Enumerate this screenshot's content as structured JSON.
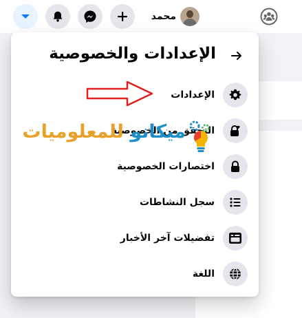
{
  "topbar": {
    "profile_name": "محمد",
    "buttons": [
      {
        "name": "account-menu-button",
        "icon": "chevron-down-icon",
        "active": true
      },
      {
        "name": "notifications-button",
        "icon": "bell-icon"
      },
      {
        "name": "messenger-button",
        "icon": "messenger-icon"
      },
      {
        "name": "create-button",
        "icon": "plus-icon"
      }
    ],
    "groups_icon": "groups-icon"
  },
  "menu": {
    "title": "الإعدادات والخصوصية",
    "back_icon": "arrow-icon",
    "items": [
      {
        "label": "الإعدادات",
        "icon": "gear-icon"
      },
      {
        "label": "التحقق من الخصوصية",
        "icon": "lock-heart-icon"
      },
      {
        "label": "اختصارات الخصوصية",
        "icon": "lock-icon"
      },
      {
        "label": "سجل النشاطات",
        "icon": "list-icon"
      },
      {
        "label": "تفضيلات آخر الأخبار",
        "icon": "feed-icon"
      },
      {
        "label": "اللغة",
        "icon": "globe-icon"
      }
    ]
  },
  "watermark": {
    "part1": "ميكانو",
    "part2": "للمعلوميات"
  },
  "colors": {
    "accent": "#1877f2",
    "arrow": "#e02020",
    "watermark_blue": "#1e8ec8",
    "watermark_orange": "#e8a22a"
  }
}
